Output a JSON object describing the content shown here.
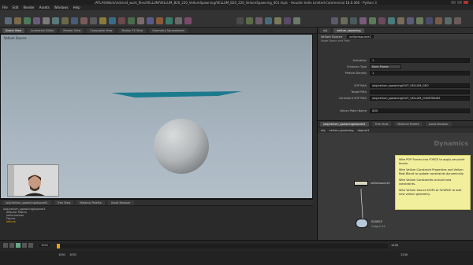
{
  "window": {
    "title": "/ATLAS/Work/vids/vid_work_files/VELLUM/VELLUM_B20_220_VellumSpawning/VELLUM_B20_220_VellumSpawning_001.hiplc - Houdini Indie Limited-Commercial 18.0.460 - Python 3"
  },
  "menubar": {
    "items": [
      "File",
      "Edit",
      "Render",
      "Assets",
      "Windows",
      "Help"
    ]
  },
  "viewport": {
    "tabs": [
      "Scene View",
      "Animation Editor",
      "Render View",
      "Composite View",
      "Motion FX View",
      "Geometry Spreadsheet"
    ],
    "label": "Vellum Source",
    "path_label": "obj",
    "path_node": "vellum_spawning"
  },
  "param_pane": {
    "tabs": [
      "obj",
      "vellum_spawning"
    ],
    "node_header": "Vellum Source",
    "node_name": "vellumsource1",
    "section": "Node Name and Path",
    "rows": [
      {
        "label": "Activation",
        "value": "1"
      },
      {
        "label": "Emission Type",
        "value": "Each Frame"
      },
      {
        "label": "Particle Density",
        "value": "1"
      },
      {
        "label": "SOP Path",
        "value": "/obj/vellum_spawning/OUT_VELLUM_GEO"
      },
      {
        "label": "Target Path",
        "value": ""
      },
      {
        "label": "Constraint SOP Path",
        "value": "/obj/vellum_spawning/OUT_VELLUM_CONSTRAINT"
      },
      {
        "label": "Vellum Patch Name",
        "value": "$OS"
      }
    ]
  },
  "network": {
    "tabs": [
      "/obj/vellum_spawning/dopnet1",
      "Tree View",
      "Material Palette",
      "Asset Browser"
    ],
    "path": "obj",
    "crumb1": "vellum_spawning",
    "crumb2": "dopnet1",
    "context_label": "Dynamics",
    "note_lines": [
      "Wire POP Forces into FORCE to apply per-point forces.",
      "Wire Vellum Constraint Properties and Vellum Rest Blend to update constraints dynamically.",
      "Wire Vellum Constraints to build new constraints.",
      "Wire Vellum Source DOPs to SOURCE to add new vellum geometry."
    ],
    "nodes": [
      {
        "name": "vellumsource1",
        "color": "#d9d6c0"
      },
      {
        "name": "SOURCE",
        "color": "#b8c8d8"
      }
    ],
    "source_sub": "Output #1"
  },
  "bottom_left": {
    "tabs": [
      "/obj/vellum_spawning/dopnet1",
      "Tree View",
      "Material Palette",
      "Asset Browser"
    ],
    "tree": [
      "/obj/vellum_spawning/dopnet1",
      "Affector Matrix",
      "vellumsolver",
      "Forces",
      "Vellum"
    ]
  },
  "timeline": {
    "start": "1001",
    "end": "1240",
    "current": "1001",
    "end_total": "1240"
  },
  "colors": {
    "accent_orange": "#e8a200",
    "plane": "#1b7a8c",
    "sphere": "#b9bdbf"
  }
}
